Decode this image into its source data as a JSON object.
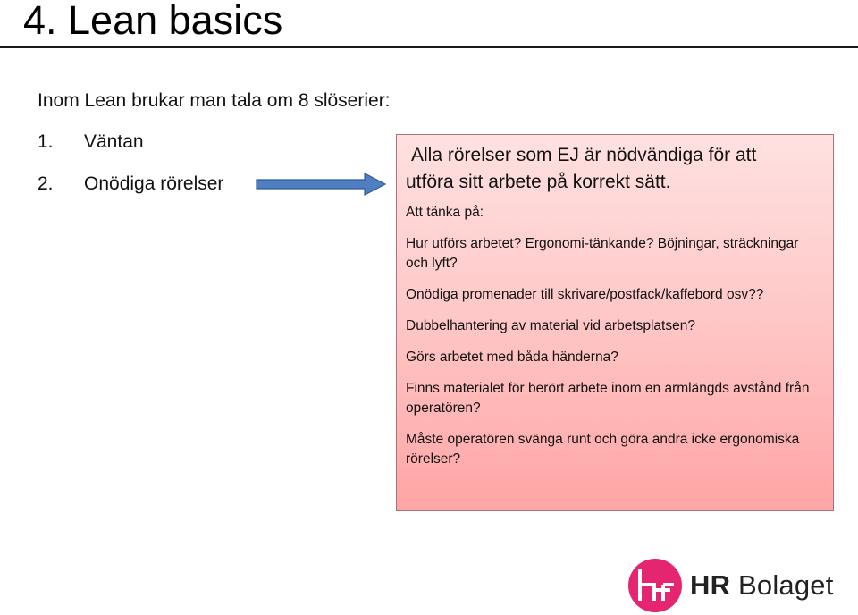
{
  "slide": {
    "title": "4. Lean basics",
    "intro": "Inom Lean brukar man tala om 8 slöserier:",
    "list": [
      {
        "number": "1.",
        "label": "Väntan"
      },
      {
        "number": "2.",
        "label": "Onödiga rörelser"
      }
    ],
    "arrow_icon": "right-arrow-icon",
    "box": {
      "heading": "Alla rörelser som EJ är nödvändiga för att utföra sitt arbete på korrekt sätt.",
      "heading_line1": "Alla rörelser som EJ är nödvändiga för att",
      "heading_line2": "utföra sitt arbete på korrekt sätt.",
      "subheading": "Att tänka på:",
      "points": [
        "Hur utförs arbetet? Ergonomi-tänkande? Böjningar, sträckningar och lyft?",
        "Onödiga promenader till skrivare/postfack/kaffebord osv??",
        "Dubbelhantering av material vid arbetsplatsen?",
        "Görs arbetet med båda händerna?",
        "Finns materialet för berört arbete inom en armlängds avstånd från operatören?",
        "Måste operatören svänga runt och göra andra icke ergonomiska rörelser?"
      ]
    },
    "logo": {
      "bold": "HR",
      "rest": " Bolaget",
      "mark_color": "#e5256f"
    },
    "colors": {
      "arrow": "#4f7fc0",
      "arrow_border": "#2f5a92",
      "box_top": "#ffe1e1",
      "box_bottom": "#ffa5a5",
      "box_border": "#b07078"
    }
  }
}
